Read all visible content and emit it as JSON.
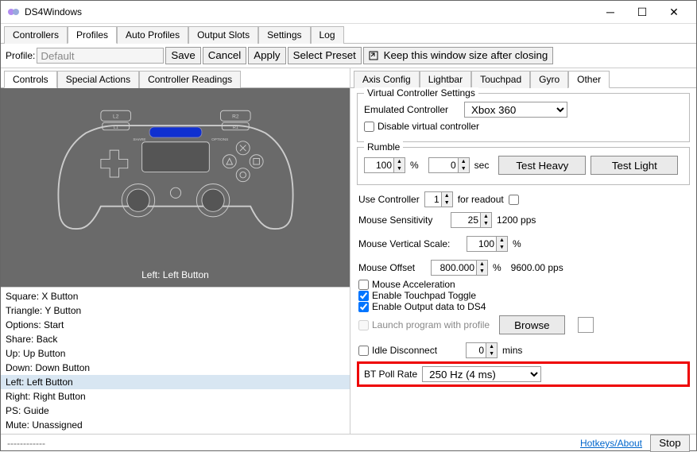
{
  "window": {
    "title": "DS4Windows"
  },
  "main_tabs": [
    "Controllers",
    "Profiles",
    "Auto Profiles",
    "Output Slots",
    "Settings",
    "Log"
  ],
  "main_tab_active": 1,
  "profile_row": {
    "label": "Profile:",
    "value": "Default",
    "save": "Save",
    "cancel": "Cancel",
    "apply": "Apply",
    "select_preset": "Select Preset",
    "keep_window": "Keep this window size after closing"
  },
  "left_subtabs": [
    "Controls",
    "Special Actions",
    "Controller Readings"
  ],
  "left_subtab_active": 0,
  "controller_label": "Left: Left Button",
  "bindings": [
    "Square: X Button",
    "Triangle: Y Button",
    "Options: Start",
    "Share: Back",
    "Up: Up Button",
    "Down: Down Button",
    "Left: Left Button",
    "Right: Right Button",
    "PS: Guide",
    "Mute: Unassigned"
  ],
  "binding_selected": 6,
  "right_subtabs": [
    "Axis Config",
    "Lightbar",
    "Touchpad",
    "Gyro",
    "Other"
  ],
  "right_subtab_active": 4,
  "vc": {
    "title": "Virtual Controller Settings",
    "label": "Emulated Controller",
    "value": "Xbox 360",
    "disable": "Disable virtual controller"
  },
  "rumble": {
    "title": "Rumble",
    "pct": "100",
    "pct_unit": "%",
    "sec": "0",
    "sec_unit": "sec",
    "heavy": "Test Heavy",
    "light": "Test Light"
  },
  "use_controller": {
    "label": "Use Controller",
    "value": "1",
    "for": "for readout"
  },
  "mouse_sens": {
    "label": "Mouse Sensitivity",
    "value": "25",
    "pps": "1200 pps"
  },
  "mouse_vs": {
    "label": "Mouse Vertical Scale:",
    "value": "100",
    "unit": "%"
  },
  "mouse_off": {
    "label": "Mouse Offset",
    "value": "800.000",
    "unit": "%",
    "pps": "9600.00 pps"
  },
  "checks": {
    "accel": "Mouse Acceleration",
    "tp": "Enable Touchpad Toggle",
    "outds4": "Enable Output data to DS4",
    "launch": "Launch program with profile"
  },
  "checks_state": {
    "accel": false,
    "tp": true,
    "outds4": true,
    "launch": false
  },
  "browse": "Browse",
  "idle": {
    "label": "Idle Disconnect",
    "value": "0",
    "unit": "mins"
  },
  "bt": {
    "label": "BT Poll Rate",
    "value": "250 Hz (4 ms)"
  },
  "footer": {
    "dash": "------------",
    "link": "Hotkeys/About",
    "stop": "Stop"
  }
}
